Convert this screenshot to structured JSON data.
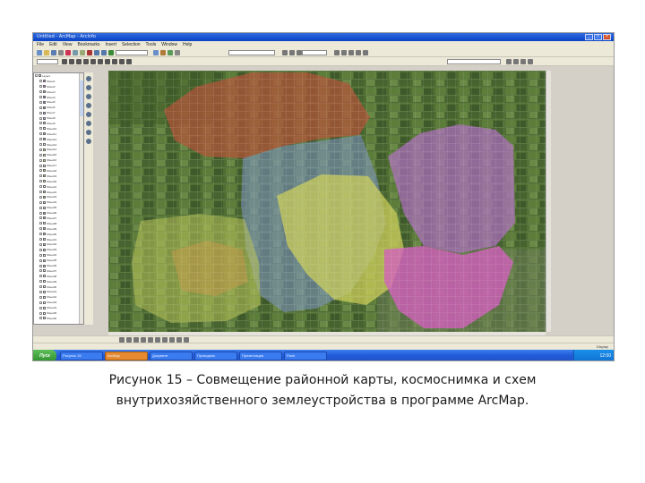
{
  "window": {
    "title": "Untitled - ArcMap - ArcInfo",
    "controls": [
      "_",
      "□",
      "×"
    ]
  },
  "menu": [
    "File",
    "Edit",
    "View",
    "Bookmarks",
    "Insert",
    "Selection",
    "Tools",
    "Window",
    "Help"
  ],
  "toc": {
    "layers": [
      {
        "label": "Layers",
        "swatch": "#ffffff"
      },
      {
        "label": "Sheet1",
        "swatch": "#b07cc6"
      },
      {
        "label": "Sheet2",
        "swatch": "#c58bc9"
      },
      {
        "label": "Sheet3",
        "swatch": "#d4a0d0"
      },
      {
        "label": "Sheet4",
        "swatch": "#9c6bb5"
      },
      {
        "label": "Sheet5",
        "swatch": "#a07abf"
      },
      {
        "label": "Sheet6",
        "swatch": "#7f9bd0"
      },
      {
        "label": "Sheet7",
        "swatch": "#8fb0d8"
      },
      {
        "label": "Sheet8",
        "swatch": "#c3b2e0"
      },
      {
        "label": "Sheet9",
        "swatch": "#d1c2e6"
      },
      {
        "label": "Sheet10",
        "swatch": "#ffffff"
      },
      {
        "label": "Sheet11",
        "swatch": "#e6a6d6"
      },
      {
        "label": "Sheet12",
        "swatch": "#d98cc8"
      },
      {
        "label": "Sheet13",
        "swatch": "#ffffff"
      },
      {
        "label": "Sheet14",
        "swatch": "#e3e06b"
      },
      {
        "label": "Sheet15",
        "swatch": "#f0ee9a"
      },
      {
        "label": "Sheet16",
        "swatch": "#cfe07a"
      },
      {
        "label": "Sheet17",
        "swatch": "#ffffff"
      },
      {
        "label": "Sheet18",
        "swatch": "#e0d36a"
      },
      {
        "label": "Sheet19",
        "swatch": "#d2c85c"
      },
      {
        "label": "Sheet20",
        "swatch": "#eee7a0"
      },
      {
        "label": "Sheet21",
        "swatch": "#ffffff"
      },
      {
        "label": "Sheet22",
        "swatch": "#b8d890"
      },
      {
        "label": "Sheet23",
        "swatch": "#a4cc7c"
      },
      {
        "label": "Sheet24",
        "swatch": "#c7e0a6"
      },
      {
        "label": "Sheet25",
        "swatch": "#ffffff"
      },
      {
        "label": "Sheet26",
        "swatch": "#7fc4a6"
      },
      {
        "label": "Sheet27",
        "swatch": "#93d0b4"
      },
      {
        "label": "Sheet28",
        "swatch": "#ffffff"
      },
      {
        "label": "Sheet29",
        "swatch": "#e0a49a"
      },
      {
        "label": "Sheet30",
        "swatch": "#e8b4aa"
      },
      {
        "label": "Sheet31",
        "swatch": "#ffffff"
      },
      {
        "label": "Sheet32",
        "swatch": "#c8c0a0"
      },
      {
        "label": "Sheet33",
        "swatch": "#d6cfb2"
      },
      {
        "label": "Sheet34",
        "swatch": "#ffffff"
      },
      {
        "label": "Sheet35",
        "swatch": "#e6c6a0"
      },
      {
        "label": "Sheet36",
        "swatch": "#efd7b8"
      },
      {
        "label": "Sheet37",
        "swatch": "#ffffff"
      },
      {
        "label": "Sheet38",
        "swatch": "#ffffff"
      },
      {
        "label": "Sheet39",
        "swatch": "#ffffff"
      },
      {
        "label": "Sheet40",
        "swatch": "#ffffff"
      },
      {
        "label": "Sheet41",
        "swatch": "#ffffff"
      },
      {
        "label": "Sheet42",
        "swatch": "#ffffff"
      },
      {
        "label": "Sheet43",
        "swatch": "#ffffff"
      },
      {
        "label": "Sheet44",
        "swatch": "#ffffff"
      },
      {
        "label": "Sheet45",
        "swatch": "#ffffff"
      },
      {
        "label": "Sheet46",
        "swatch": "#ffffff"
      }
    ]
  },
  "map": {
    "colors": {
      "red": "#b4553a",
      "yellow": "#cfd05a",
      "purple": "#b46fc8",
      "magenta": "#d35fbf",
      "blue": "#7f98c8",
      "orange": "#c89a4a",
      "imagery": "#4e6b34"
    }
  },
  "status": "Display",
  "taskbar": {
    "start": "Пуск",
    "buttons": [
      "Рисунок 15",
      "ArcMap",
      "Документ",
      "Проводник",
      "Презентация",
      "Paint"
    ],
    "active_index": 1,
    "clock": "12:00"
  },
  "caption": {
    "line1": "Рисунок 15 –  Совмещение районной карты, космоснимка и схем",
    "line2": "внутрихозяйственного землеустройства в программе ArcMap."
  }
}
